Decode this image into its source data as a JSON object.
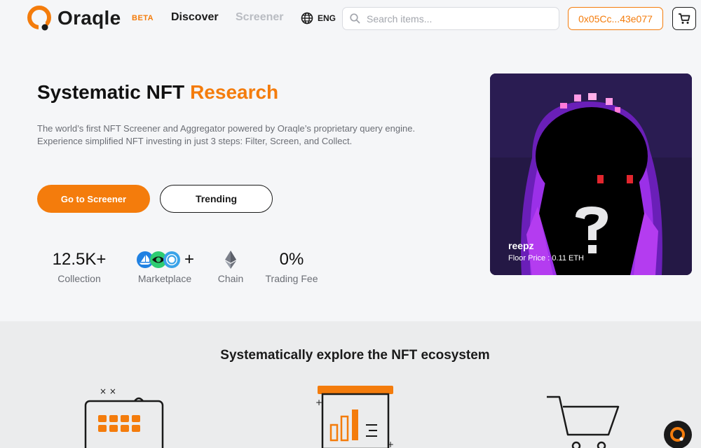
{
  "header": {
    "logo_text": "Oraqle",
    "beta_label": "BETA",
    "nav": {
      "discover": "Discover",
      "screener": "Screener"
    },
    "language": "ENG",
    "search_placeholder": "Search items...",
    "wallet_address": "0x05Cc...43e077"
  },
  "hero": {
    "title_main": "Systematic NFT",
    "title_accent": "Research",
    "description_line1": "The world’s first NFT Screener and Aggregator powered by Oraqle’s proprietary query engine.",
    "description_line2": "Experience simplified NFT investing in just 3 steps: Filter, Screen, and Collect.",
    "primary_button": "Go to Screener",
    "secondary_button": "Trending"
  },
  "stats": [
    {
      "value": "12.5K+",
      "label": "Collection"
    },
    {
      "value": "+",
      "label": "Marketplace"
    },
    {
      "value": "",
      "label": "Chain"
    },
    {
      "value": "0%",
      "label": "Trading Fee"
    }
  ],
  "featured_nft": {
    "name": "reepz",
    "floor_price": "Floor Price : 0.11 ETH"
  },
  "section": {
    "title": "Systematically explore the NFT ecosystem"
  },
  "colors": {
    "accent": "#f47c0c",
    "text": "#1a1a1a",
    "muted": "#6b6e75",
    "nft_background": "#221640",
    "nft_glow": "#8a2be2"
  },
  "icons": [
    "search-icon",
    "globe-icon",
    "cart-icon",
    "ethereum-icon",
    "opensea-icon",
    "looksrare-icon",
    "x2y2-icon",
    "calendar-grid-icon",
    "bar-chart-board-icon",
    "shopping-cart-icon",
    "chat-help-icon"
  ]
}
